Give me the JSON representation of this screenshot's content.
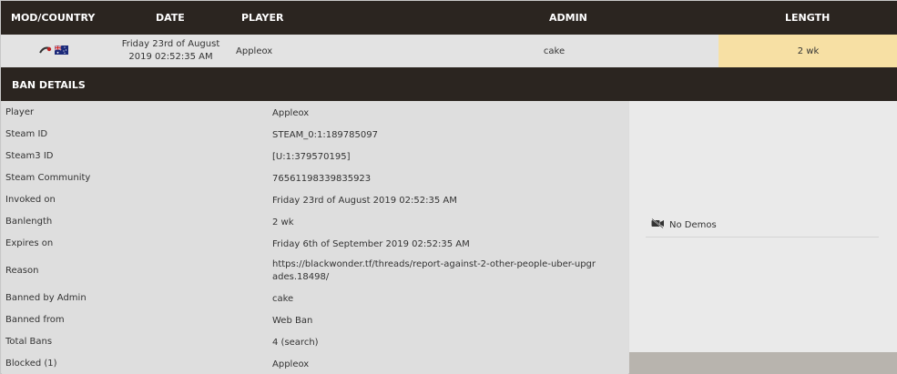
{
  "header": {
    "mod_country": "MOD/COUNTRY",
    "date": "DATE",
    "player": "PLAYER",
    "admin": "ADMIN",
    "length": "LENGTH"
  },
  "summary": {
    "mod_icon": "tf2-mod-icon",
    "country_flag": "australia-flag-icon",
    "date_line1": "Friday 23rd of August",
    "date_line2": "2019 02:52:35 AM",
    "player": "Appleox",
    "admin": "cake",
    "length": "2 wk"
  },
  "details_bar": {
    "title": "BAN DETAILS"
  },
  "details": [
    {
      "label": "Player",
      "value": "Appleox"
    },
    {
      "label": "Steam ID",
      "value": "STEAM_0:1:189785097"
    },
    {
      "label": "Steam3 ID",
      "value": "[U:1:379570195]"
    },
    {
      "label": "Steam Community",
      "value": "76561198339835923"
    },
    {
      "label": "Invoked on",
      "value": "Friday 23rd of August 2019 02:52:35 AM"
    },
    {
      "label": "Banlength",
      "value": "2 wk"
    },
    {
      "label": "Expires on",
      "value": "Friday 6th of September 2019 02:52:35 AM"
    },
    {
      "label": "Reason",
      "value": "https://blackwonder.tf/threads/report-against-2-other-people-uber-upgrades.18498/"
    },
    {
      "label": "Banned by Admin",
      "value": "cake"
    },
    {
      "label": "Banned from",
      "value": "Web Ban"
    },
    {
      "label": "Total Bans",
      "value": "4 (search)"
    },
    {
      "label": "Blocked (1)",
      "value": "Appleox"
    }
  ],
  "demos": {
    "icon": "video-off-icon",
    "label": "No Demos"
  },
  "colors": {
    "header_bg": "#2b2520",
    "row_bg": "#e3e3e3",
    "length_bg": "#f7e0a4",
    "details_bg": "#dedede",
    "panel_bg": "#eaeaea"
  }
}
